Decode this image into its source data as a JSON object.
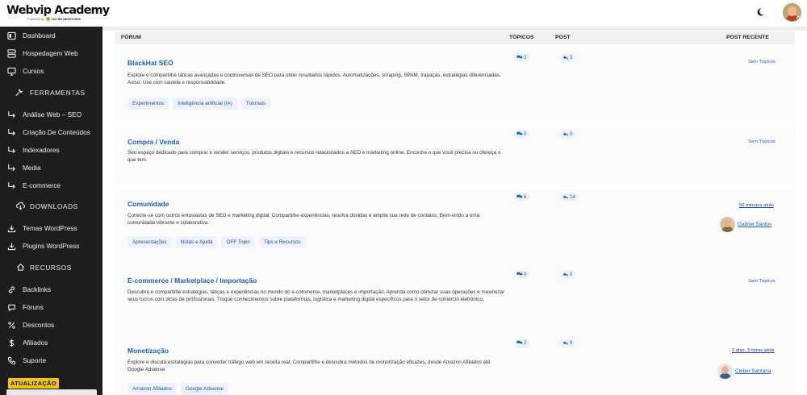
{
  "app": {
    "logo_title": "Webvip Academy",
    "logo_sub_prefix": "Powered by",
    "logo_sub_brand": "GO DE NEGOCIOS"
  },
  "sidebar": {
    "items": [
      {
        "label": "Dashboard",
        "icon": "dashboard-icon"
      },
      {
        "label": "Hospedagem Web",
        "icon": "server-icon"
      },
      {
        "label": "Cursos",
        "icon": "monitor-icon"
      }
    ],
    "section_tools": {
      "label": "FERRAMENTAS",
      "icon": "wrench-icon"
    },
    "tools": [
      {
        "label": "Análise Web – SEO"
      },
      {
        "label": "Criação De Conteúdos"
      },
      {
        "label": "Indexadores"
      },
      {
        "label": "Media"
      },
      {
        "label": "E-commerce"
      }
    ],
    "section_downloads": {
      "label": "DOWNLOADS",
      "icon": "cloud-download-icon"
    },
    "downloads": [
      {
        "label": "Temas WordPress",
        "icon": "download-icon"
      },
      {
        "label": "Plugins WordPress",
        "icon": "download-icon"
      }
    ],
    "section_resources": {
      "label": "RECURSOS",
      "icon": "home-icon"
    },
    "resources": [
      {
        "label": "Backlinks",
        "icon": "link-icon"
      },
      {
        "label": "Fóruns",
        "icon": "chat-icon"
      },
      {
        "label": "Descontos",
        "icon": "percent-icon"
      },
      {
        "label": "Afiliados",
        "icon": "dollar-icon"
      },
      {
        "label": "Suporte",
        "icon": "phone-icon"
      }
    ],
    "update_badge": "ATUALIZAÇÃO"
  },
  "table": {
    "headers": {
      "forum": "FÓRUM",
      "topics": "TÓPICOS",
      "posts": "POST",
      "recent": "POST RECENTE"
    },
    "rows": [
      {
        "title": "BlackHat SEO",
        "description": "Explore e compartilhe táticas avançadas e controversas de SEO para obter resultados rápidos. Automatizações, scraping, SPAM, trapaças, estratégias diferenciadas. Aviso: Use com cautela e responsabilidade.",
        "tags": [
          "Experimentos",
          "Inteligência artificial (IA)",
          "Tutoriais"
        ],
        "topics": "3",
        "posts": "3",
        "recent": "Sem Tópicos"
      },
      {
        "title": "Compra / Venda",
        "description": "Seu espaço dedicado para comprar e vender serviços, produtos digitais e recursos relacionados a SEO e marketing online. Encontre o que você precisa ou ofereça o que tem.",
        "tags": [],
        "topics": "0",
        "posts": "0",
        "recent": "Sem Tópicos"
      },
      {
        "title": "Comunidade",
        "description": "Conecte-se com outros entusiastas de SEO e marketing digital. Compartilhe experiências, resolva dúvidas e amplie sua rede de contatos. Bem-vindo a uma comunidade vibrante e colaborativa.",
        "tags": [
          "Apresentações",
          "Notas e Ajuda",
          "OFF Topic",
          "Tips e Recursos"
        ],
        "topics": "6",
        "posts": "14",
        "recent_time": "56 minutos atrás",
        "recent_user": "Gabriel Santos"
      },
      {
        "title": "E-commerce / Marketplace / Importação",
        "description": "Descubra e compartilhe estratégias, táticas e experiências no mundo do e-commerce, marketplaces e importação. Aprenda como otimizar suas operações e maximizar seus lucros com dicas de profissionais. Troque conhecimentos sobre plataformas, logística e marketing digital específicos para o setor de comércio eletrônico.",
        "tags": [],
        "topics": "0",
        "posts": "0",
        "recent": "Sem Tópicos"
      },
      {
        "title": "Monetização",
        "description": "Explore e discuta estratégias para converter tráfego web em receita real. Compartilhe e descubra métodos de monetização eficazes, desde Amazon Afiliados até Google Adsense.",
        "tags": [
          "Amazon Afiliados",
          "Google Adsense"
        ],
        "topics": "2",
        "posts": "9",
        "recent_time": "2 dias, 3 horas atrás",
        "recent_user": "Cleber Santana"
      }
    ]
  }
}
